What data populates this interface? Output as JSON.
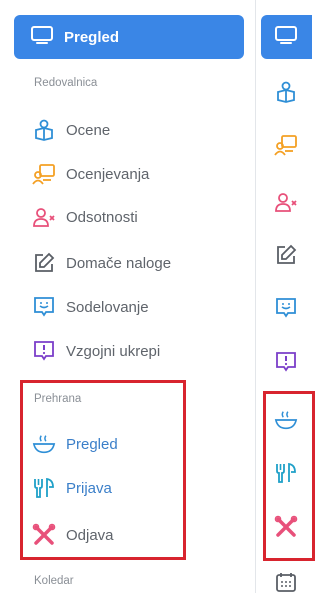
{
  "sidebar": {
    "active": {
      "label": "Pregled",
      "icon": "monitor-icon"
    },
    "sections": {
      "redovalnica": "Redovalnica",
      "prehrana": "Prehrana",
      "koledar": "Koledar"
    },
    "items": {
      "ocene": {
        "label": "Ocene",
        "icon": "student-icon"
      },
      "ocenjevanja": {
        "label": "Ocenjevanja",
        "icon": "teacher-board-icon"
      },
      "odsotnosti": {
        "label": "Odsotnosti",
        "icon": "user-x-icon"
      },
      "domace": {
        "label": "Domače naloge",
        "icon": "edit-icon"
      },
      "sodelovanje": {
        "label": "Sodelovanje",
        "icon": "smile-chat-icon"
      },
      "vzgojni": {
        "label": "Vzgojni ukrepi",
        "icon": "alert-chat-icon"
      },
      "prehrana_pregled": {
        "label": "Pregled",
        "icon": "bowl-icon"
      },
      "prijava": {
        "label": "Prijava",
        "icon": "cutlery-icon"
      },
      "odjava": {
        "label": "Odjava",
        "icon": "cutlery-cross-icon"
      }
    }
  },
  "colors": {
    "accent": "#3a86e6",
    "highlight_box": "#d8242e",
    "orange_icon": "#f4a024",
    "pink_icon": "#e8507a",
    "purple_icon": "#7b3ec9",
    "blue_icon": "#2f8fd6"
  }
}
